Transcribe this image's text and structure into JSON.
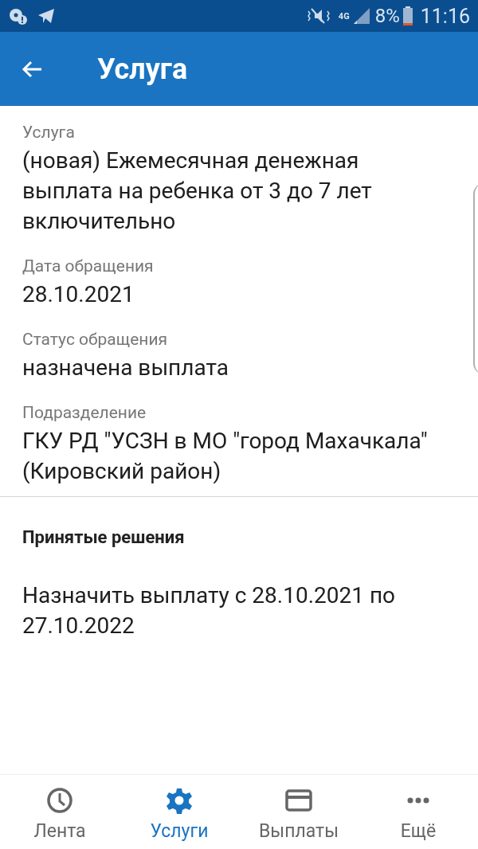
{
  "status_bar": {
    "network": "4G",
    "battery": "8%",
    "time": "11:16"
  },
  "app_bar": {
    "title": "Услуга"
  },
  "fields": [
    {
      "label": "Услуга",
      "value": "(новая) Ежемесячная денежная выплата на ребенка от 3 до 7 лет включительно"
    },
    {
      "label": "Дата обращения",
      "value": "28.10.2021"
    },
    {
      "label": "Статус обращения",
      "value": "назначена выплата"
    },
    {
      "label": "Подразделение",
      "value": "ГКУ РД \"УСЗН в МО \"город Махачкала\" (Кировский район)"
    }
  ],
  "decisions": {
    "title": "Принятые решения",
    "items": [
      "Назначить выплату с 28.10.2021 по 27.10.2022"
    ]
  },
  "bottom_nav": [
    {
      "kind": "clock",
      "label": "Лента",
      "selected": false
    },
    {
      "kind": "gear",
      "label": "Услуги",
      "selected": true
    },
    {
      "kind": "card",
      "label": "Выплаты",
      "selected": false
    },
    {
      "kind": "more",
      "label": "Ещё",
      "selected": false
    }
  ]
}
